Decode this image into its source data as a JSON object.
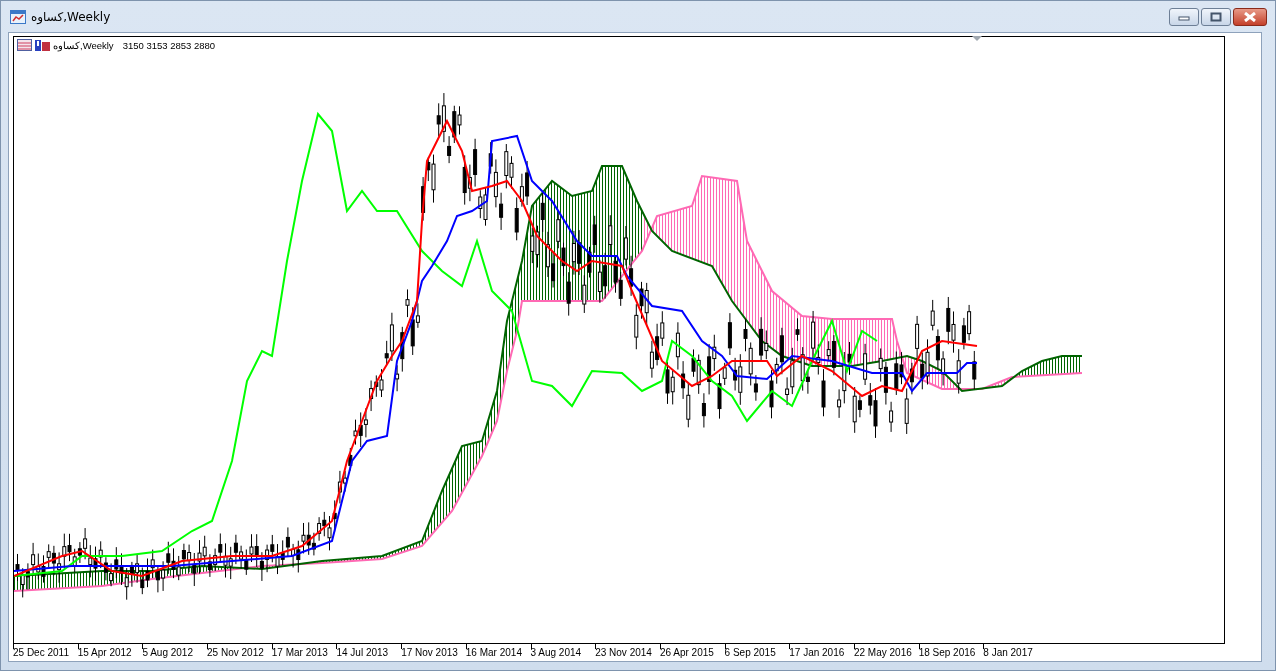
{
  "window": {
    "title": "کساوه,Weekly"
  },
  "chart": {
    "symbol": "کساوه,Weekly",
    "prices": "3150 3153 2853 2880",
    "x_labels": [
      "25 Dec 2011",
      "15 Apr 2012",
      "5 Aug 2012",
      "25 Nov 2012",
      "17 Mar 2013",
      "14 Jul 2013",
      "17 Nov 2013",
      "16 Mar 2014",
      "3 Aug 2014",
      "23 Nov 2014",
      "26 Apr 2015",
      "6 Sep 2015",
      "17 Jan 2016",
      "22 May 2016",
      "18 Sep 2016",
      "8 Jan 2017"
    ]
  }
}
